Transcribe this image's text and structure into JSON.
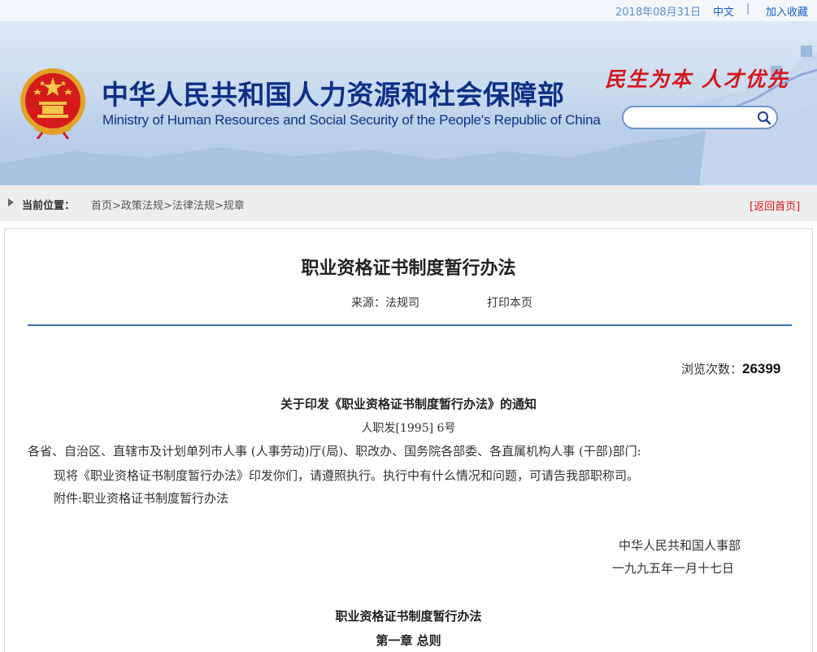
{
  "topbar": {
    "date": "2018年08月31日",
    "lang": "中文",
    "separator": "|",
    "favorite": "加入收藏"
  },
  "header": {
    "title_cn": "中华人民共和国人力资源和社会保障部",
    "title_en": "Ministry of Human Resources and Social Security of the People's Republic of China",
    "slogan": "民生为本 人才优先",
    "search_placeholder": "",
    "icons": {
      "emblem": "national-emblem",
      "search": "search-icon"
    }
  },
  "breadcrumb": {
    "label": "当前位置：",
    "items": [
      "首页",
      "政策法规",
      "法律法规",
      "规章"
    ],
    "separator": ">",
    "back_open": "[",
    "back": "返回首页",
    "back_close": "]"
  },
  "article": {
    "title": "职业资格证书制度暂行办法",
    "source": "来源：法规司",
    "print": "打印本页",
    "views_label": "浏览次数：",
    "views": "26399",
    "notice_title": "关于印发《职业资格证书制度暂行办法》的通知",
    "doc_no": "人职发[1995] 6号",
    "paragraphs": [
      "各省、自治区、直辖市及计划单列市人事 (人事劳动)厅(局)、职改办、国务院各部委、各直属机构人事 (干部)部门:",
      "现将《职业资格证书制度暂行办法》印发你们，请遵照执行。执行中有什么情况和问题，可请告我部职称司。",
      "附件:职业资格证书制度暂行办法"
    ],
    "signature_org": "中华人民共和国人事部",
    "signature_date": "一九九五年一月十七日",
    "section_title": "职业资格证书制度暂行办法",
    "chapter": "第一章  总则"
  },
  "colors": {
    "brand_blue": "#0f2f86",
    "red": "#d4161b",
    "link_blue": "#1a63c7",
    "rule_blue": "#3b6fb0"
  }
}
